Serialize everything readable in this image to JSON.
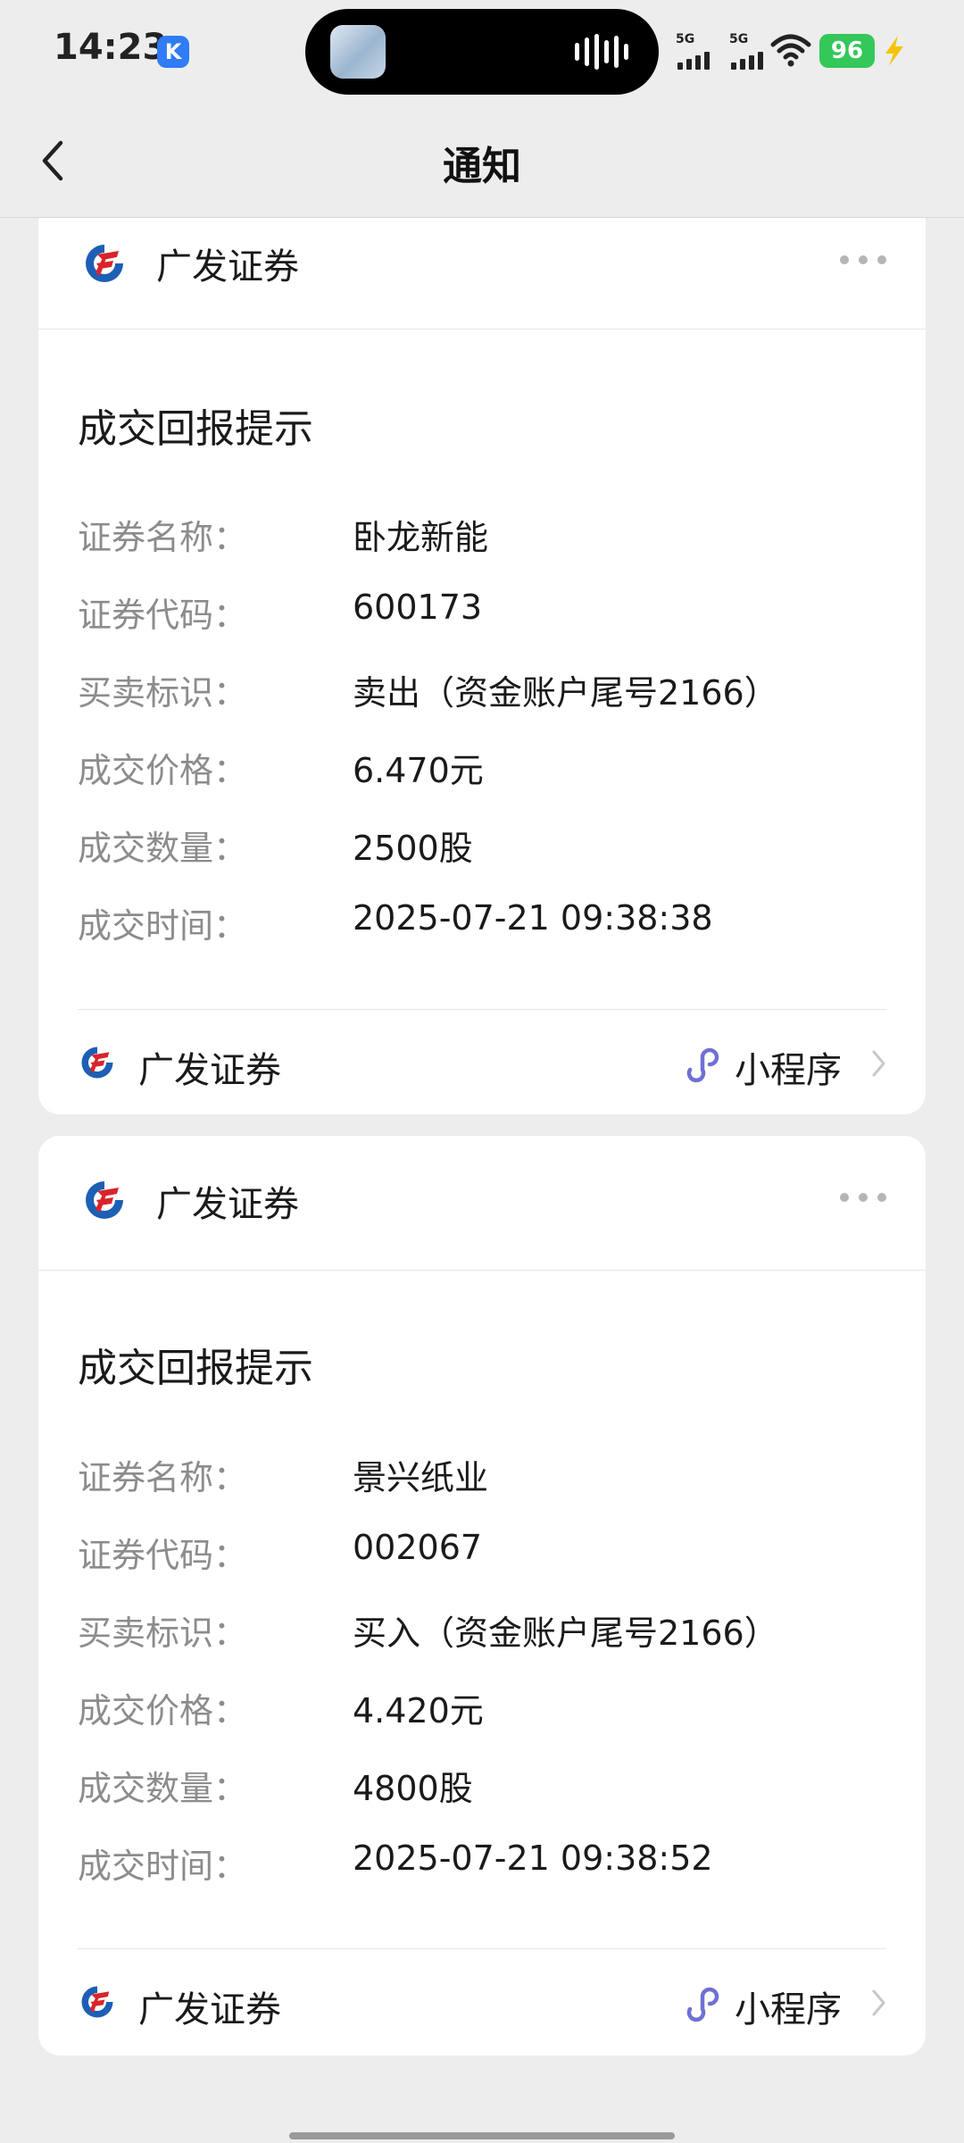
{
  "status_bar": {
    "time": "14:23",
    "k_badge": "K",
    "signal_1": "5G",
    "signal_2": "5G",
    "battery": "96",
    "icons": [
      "k-app-icon",
      "signal-icon",
      "wifi-icon",
      "battery-icon",
      "charging-bolt-icon"
    ]
  },
  "nav": {
    "title": "通知",
    "back_icon": "chevron-left-icon"
  },
  "cards": [
    {
      "brand": "广发证券",
      "notice_title": "成交回报提示",
      "fields": [
        {
          "label": "证券名称：",
          "value": "卧龙新能"
        },
        {
          "label": "证券代码：",
          "value": "600173"
        },
        {
          "label": "买卖标识：",
          "value": "卖出（资金账户尾号2166）"
        },
        {
          "label": "成交价格：",
          "value": "6.470元"
        },
        {
          "label": "成交数量：",
          "value": "2500股"
        },
        {
          "label": "成交时间：",
          "value": "2025-07-21 09:38:38"
        }
      ],
      "footer_brand": "广发证券",
      "footer_action": "小程序"
    },
    {
      "brand": "广发证券",
      "notice_title": "成交回报提示",
      "fields": [
        {
          "label": "证券名称：",
          "value": "景兴纸业"
        },
        {
          "label": "证券代码：",
          "value": "002067"
        },
        {
          "label": "买卖标识：",
          "value": "买入（资金账户尾号2166）"
        },
        {
          "label": "成交价格：",
          "value": "4.420元"
        },
        {
          "label": "成交数量：",
          "value": "4800股"
        },
        {
          "label": "成交时间：",
          "value": "2025-07-21 09:38:52"
        }
      ],
      "footer_brand": "广发证券",
      "footer_action": "小程序"
    }
  ],
  "colors": {
    "background": "#ededed",
    "card": "#ffffff",
    "label_gray": "#8c8c8c",
    "brand_red": "#d9242b",
    "brand_blue": "#1d5fb5",
    "miniprogram_purple": "#6f6fd6",
    "battery_green": "#34c759",
    "bolt_yellow": "#f5c400"
  }
}
